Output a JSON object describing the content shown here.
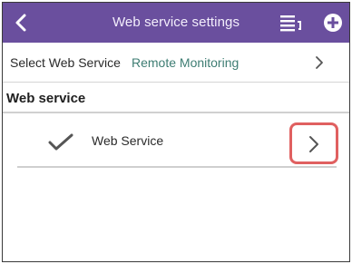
{
  "appbar": {
    "title": "Web service settings",
    "back_icon": "chevron-left-icon",
    "list_icon": "list-view-icon",
    "add_icon": "add-circle-icon",
    "color": "#6a4f9e"
  },
  "select_service": {
    "label": "Select Web Service",
    "value": "Remote Monitoring",
    "value_color": "#3e7d73",
    "chevron_icon": "chevron-right-icon"
  },
  "section": {
    "title": "Web service"
  },
  "items": [
    {
      "label": "Web Service",
      "checked": true,
      "check_icon": "check-icon",
      "chevron_icon": "chevron-right-icon",
      "highlight_color": "#e06060"
    }
  ]
}
